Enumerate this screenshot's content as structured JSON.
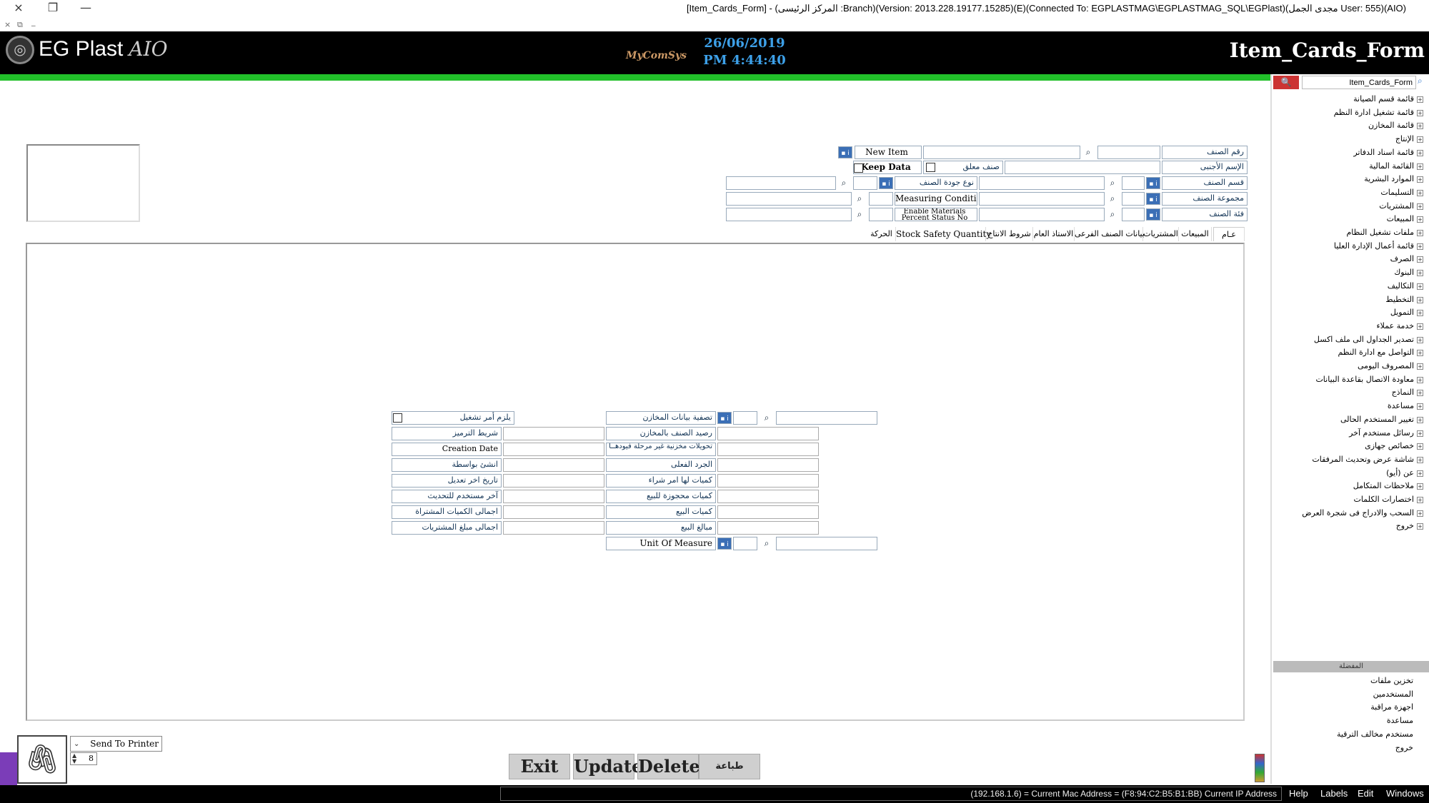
{
  "window": {
    "title": "[Item_Cards_Form] - (المركز الرئيسى :Branch)(Version: 2013.228.19177.15285)(E)(Connected To: EGPLASTMAG\\EGPLASTMAG_SQL\\EGPlast)(مجدى الجمل User: 555)(AIO)",
    "close_icon": "×",
    "restore_icon": "❐",
    "minimize_icon": "—",
    "mdi_close": "×",
    "mdi_restore": "⧉",
    "mdi_min": "_"
  },
  "header": {
    "logo_text": "EG Plast",
    "logo_suffix": "AIO",
    "brand": "MyComSys",
    "date": "26/06/2019",
    "time": "PM 4:44:40",
    "form_title": "Item_Cards_Form"
  },
  "sidebar": {
    "search_value": "Item_Cards_Form",
    "tree": [
      "قائمة قسم الصيانة",
      "قائمة تشغيل ادارة النظم",
      "قائمة المخازن",
      "الإنتاج",
      "قائمة اسناد الدفاتر",
      "القائمة المالية",
      "الموارد البشرية",
      "التسليمات",
      "المشتريات",
      "المبيعات",
      "ملفات تشغيل النظام",
      "قائمة أعمال الإدارة العليا",
      "الصرف",
      "البنوك",
      "التكاليف",
      "التخطيط",
      "التمويل",
      "خدمة عملاء",
      "تصدير الجداول الى ملف اكسل",
      "التواصل مع ادارة النظم",
      "المصروف اليومى",
      "معاودة الاتصال بقاعدة البيانات",
      "النماذج",
      "مساعدة",
      "تغيير المستخدم الحالى",
      "رسائل مستخدم آخر",
      "خصائص جهازى",
      "شاشة عرض وتحديث المرفقات",
      "عن (أيو)",
      "ملاحظات المتكامل",
      "اختصارات الكلمات",
      "السحب والادراج فى شجرة العرض",
      "خروج"
    ],
    "favorites_header": "المفضلة",
    "favorites": [
      "تخزين ملفات",
      "المستخدمين",
      "اجهزة مراقبة",
      "مساعدة",
      "مستخدم مخالف الترقية",
      "خروج"
    ]
  },
  "form": {
    "item_no_label": "رقم الصنف",
    "foreign_name_label": "الإسم الأجنبى",
    "new_item_label": "New Item",
    "keep_data_label": "Keep Data",
    "closed_item_label": "صنف معلق",
    "section_label": "قسم الصنف",
    "group_label": "مجموعة الصنف",
    "category_label": "فئة الصنف",
    "quality_type_label": "نوع جودة الصنف",
    "measuring_condition_label": "Measuring Condition",
    "enable_materials_label": "Enable Materials Percent Status No"
  },
  "tabs": [
    {
      "label": "عـام",
      "active": true
    },
    {
      "label": "المبيعات",
      "active": false
    },
    {
      "label": "المشتريات",
      "active": false
    },
    {
      "label": "بيانات الصنف الفرعى",
      "active": false
    },
    {
      "label": "الاستاذ العام",
      "active": false
    },
    {
      "label": "شروط الانتاج",
      "active": false
    },
    {
      "label": "Stock Safety Quantity",
      "active": false
    },
    {
      "label": "الحركة",
      "active": false
    }
  ],
  "general": {
    "left_labels": [
      "يلزم أمر تشغيل",
      "شريط الترميز",
      "Creation Date",
      "انشئ بواسطة",
      "تاريخ اخر تعديل",
      "آخر مستخدم للتحديث",
      "اجمالى الكميات المشتراة",
      "اجمالى مبلغ المشتريات"
    ],
    "right_labels": [
      "تصفية بيانات المخازن",
      "رصيد الصنف بالمخازن",
      "تحويلات مخزنية غير مرحلة فيودهــا",
      "الجرد الفعلى",
      "كميات لها امر شراء",
      "كميات محجوزة للبيع",
      "كميات البيع",
      "مبالغ البيع"
    ],
    "unit_label": "Unit Of Measure"
  },
  "bottom": {
    "printer_option": "Send To Printer",
    "copies": "8",
    "attach_icon": "🖇",
    "buttons": {
      "exit": "Exit",
      "update": "Update",
      "delete": "Delete",
      "print": "طباعة"
    }
  },
  "statusbar": {
    "ip_text": "(192.168.1.6) = Current Mac Address = (F8:94:C2:B5:B1:BB) Current IP Address",
    "menu": [
      "Help",
      "Labels",
      "Edit",
      "Windows"
    ]
  }
}
